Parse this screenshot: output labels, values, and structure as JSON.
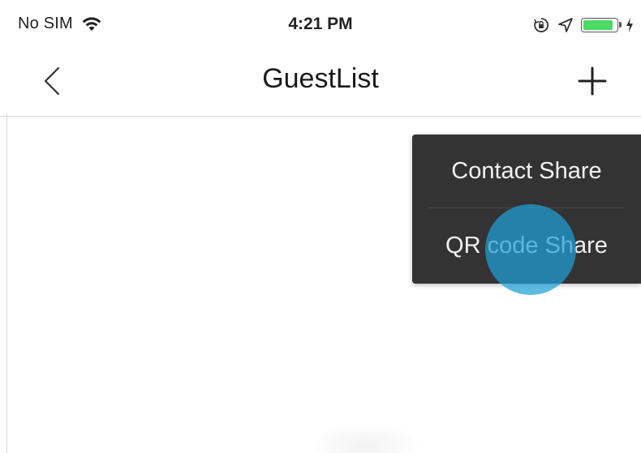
{
  "status_bar": {
    "carrier": "No SIM",
    "time": "4:21 PM",
    "battery_level": 0.9,
    "battery_color": "#4cd964",
    "icons": [
      "wifi-icon",
      "orientation-lock-icon",
      "location-arrow-icon",
      "battery-icon",
      "charging-bolt-icon"
    ]
  },
  "nav": {
    "title": "GuestList",
    "back_icon": "chevron-left-icon",
    "add_icon": "plus-icon"
  },
  "popover": {
    "background": "#333333",
    "items": [
      {
        "label": "Contact Share"
      },
      {
        "label": "QR code Share"
      }
    ]
  },
  "touch_indicator": {
    "color": "#1ea0d7"
  }
}
